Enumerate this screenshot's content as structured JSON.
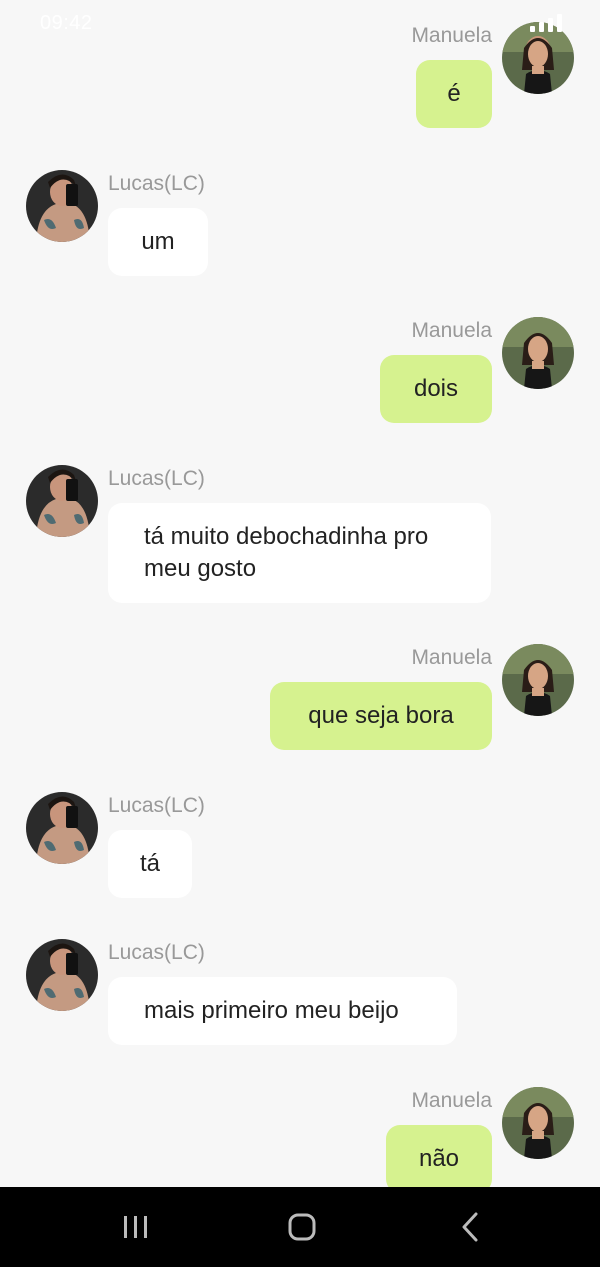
{
  "status_bar": {
    "time": "09:42"
  },
  "contacts": {
    "me": "Manuela",
    "other": "Lucas(LC)"
  },
  "messages": [
    {
      "sender": "Manuela",
      "text": "é"
    },
    {
      "sender": "Lucas(LC)",
      "text": "um"
    },
    {
      "sender": "Manuela",
      "text": "dois"
    },
    {
      "sender": "Lucas(LC)",
      "text": "tá muito debochadinha pro meu gosto"
    },
    {
      "sender": "Manuela",
      "text": "que seja bora"
    },
    {
      "sender": "Lucas(LC)",
      "text": "tá"
    },
    {
      "sender": "Lucas(LC)",
      "text": "mais primeiro meu beijo"
    },
    {
      "sender": "Manuela",
      "text": "não"
    }
  ],
  "colors": {
    "background": "#f7f7f7",
    "outgoing_bubble": "#d6f28f",
    "incoming_bubble": "#ffffff",
    "sender_name": "#999999",
    "nav_bar": "#000000"
  },
  "icons": {
    "nav_recent": "recent-apps-icon",
    "nav_home": "home-icon",
    "nav_back": "back-icon"
  }
}
